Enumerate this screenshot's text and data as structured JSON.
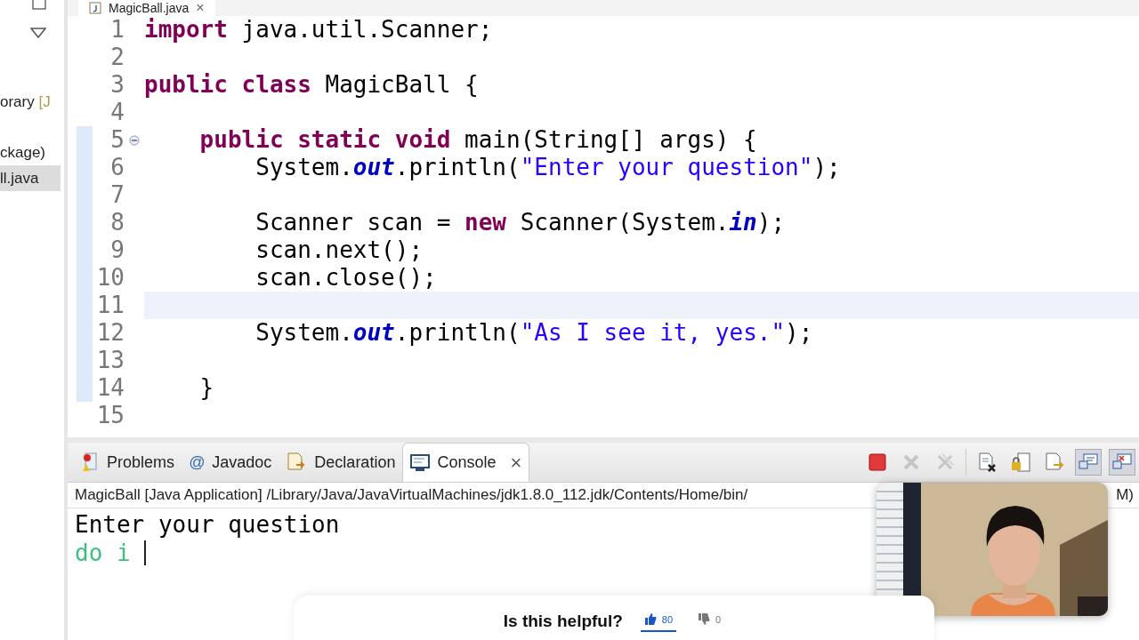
{
  "project_explorer": {
    "items": [
      {
        "label": "orary",
        "suffix": "[J",
        "selected": false
      },
      {
        "label": "ckage)",
        "selected": false
      },
      {
        "label": "ll.java",
        "selected": true
      }
    ]
  },
  "editor": {
    "tab": {
      "title": "MagicBall.java",
      "close": "×"
    },
    "lines": [
      {
        "number": "1",
        "tokens": [
          {
            "kind": "kw",
            "text": "import"
          },
          {
            "kind": "plain",
            "text": " java.util.Scanner;"
          }
        ]
      },
      {
        "number": "2"
      },
      {
        "number": "3",
        "tokens": [
          {
            "kind": "kw",
            "text": "public class"
          },
          {
            "kind": "plain",
            "text": " MagicBall {"
          }
        ]
      },
      {
        "number": "4"
      },
      {
        "number": "5",
        "foldable": true,
        "changed": true,
        "tokens": [
          {
            "kind": "kw",
            "text": "    public static void"
          },
          {
            "kind": "plain",
            "text": " main(String[] args) {"
          }
        ]
      },
      {
        "number": "6",
        "changed": true,
        "tokens": [
          {
            "kind": "plain",
            "text": "        System."
          },
          {
            "kind": "field",
            "text": "out"
          },
          {
            "kind": "plain",
            "text": ".println("
          },
          {
            "kind": "str",
            "text": "\"Enter your question\""
          },
          {
            "kind": "plain",
            "text": ");"
          }
        ]
      },
      {
        "number": "7",
        "changed": true
      },
      {
        "number": "8",
        "changed": true,
        "tokens": [
          {
            "kind": "plain",
            "text": "        Scanner scan = "
          },
          {
            "kind": "kw",
            "text": "new"
          },
          {
            "kind": "plain",
            "text": " Scanner(System."
          },
          {
            "kind": "field",
            "text": "in"
          },
          {
            "kind": "plain",
            "text": ");"
          }
        ]
      },
      {
        "number": "9",
        "changed": true,
        "tokens": [
          {
            "kind": "plain",
            "text": "        scan.next();"
          }
        ]
      },
      {
        "number": "10",
        "changed": true,
        "tokens": [
          {
            "kind": "plain",
            "text": "        scan.close();"
          }
        ]
      },
      {
        "number": "11",
        "changed": true,
        "current": true
      },
      {
        "number": "12",
        "changed": true,
        "tokens": [
          {
            "kind": "plain",
            "text": "        System."
          },
          {
            "kind": "field",
            "text": "out"
          },
          {
            "kind": "plain",
            "text": ".println("
          },
          {
            "kind": "str",
            "text": "\"As I see it, yes.\""
          },
          {
            "kind": "plain",
            "text": ");"
          }
        ]
      },
      {
        "number": "13",
        "changed": true
      },
      {
        "number": "14",
        "changed": true,
        "tokens": [
          {
            "kind": "plain",
            "text": "    }"
          }
        ]
      },
      {
        "number": "15"
      }
    ]
  },
  "bottom_panel": {
    "tabs": [
      {
        "label": "Problems",
        "selected": false
      },
      {
        "label": "Javadoc",
        "glyph": "@",
        "selected": false
      },
      {
        "label": "Declaration",
        "selected": false
      },
      {
        "label": "Console",
        "selected": true,
        "close": "×"
      }
    ],
    "toolbar": [
      {
        "kind": "terminate",
        "disabled": false,
        "pressed": false
      },
      {
        "kind": "remove",
        "disabled": true,
        "pressed": false
      },
      {
        "kind": "remove_all",
        "disabled": true,
        "pressed": false
      },
      {
        "kind": "clear",
        "disabled": false,
        "pressed": false
      },
      {
        "kind": "scroll_lock",
        "disabled": false,
        "pressed": false
      },
      {
        "kind": "pin",
        "disabled": false,
        "pressed": false
      },
      {
        "kind": "display",
        "disabled": false,
        "pressed": true
      },
      {
        "kind": "open",
        "disabled": false,
        "pressed": true
      }
    ],
    "console": {
      "header": "MagicBall [Java Application] /Library/Java/JavaVirtualMachines/jdk1.8.0_112.jdk/Contents/Home/bin/",
      "header_end": "M)",
      "lines": [
        {
          "kind": "output",
          "text": "Enter your question"
        },
        {
          "kind": "input",
          "text": "do i ",
          "caret": true
        }
      ]
    }
  },
  "feedback": {
    "question": "Is this helpful?",
    "like": {
      "count": "80",
      "selected": true
    },
    "dislike": {
      "count": "0",
      "selected": false
    }
  }
}
